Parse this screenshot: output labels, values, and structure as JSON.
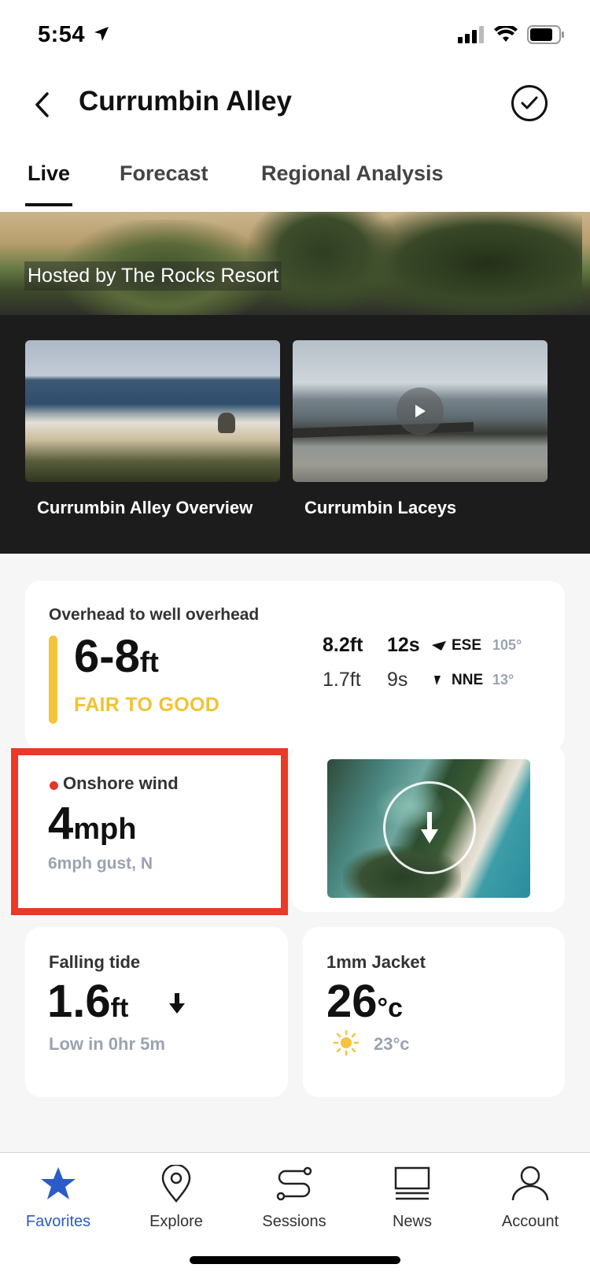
{
  "status_bar": {
    "time": "5:54"
  },
  "header": {
    "title": "Currumbin Alley"
  },
  "tabs": [
    {
      "label": "Live",
      "active": true
    },
    {
      "label": "Forecast",
      "active": false
    },
    {
      "label": "Regional Analysis",
      "active": false
    }
  ],
  "hero": {
    "hosted_by": "Hosted by The Rocks Resort"
  },
  "cameras": [
    {
      "label": "Currumbin Alley Overview"
    },
    {
      "label": "Currumbin Laceys"
    }
  ],
  "surf": {
    "description": "Overhead to well overhead",
    "height": "6-8",
    "unit": "ft",
    "rating": "FAIR TO GOOD",
    "rating_color": "#f1c332",
    "swells": [
      {
        "height": "8.2ft",
        "period": "12s",
        "direction": "ESE",
        "degrees": "105°"
      },
      {
        "height": "1.7ft",
        "period": "9s",
        "direction": "NNE",
        "degrees": "13°"
      }
    ]
  },
  "wind": {
    "label": "Onshore wind",
    "speed": "4",
    "unit": "mph",
    "gust": "6mph gust, N",
    "indicator_color": "#e0372b"
  },
  "tide": {
    "label": "Falling tide",
    "height": "1.6",
    "unit": "ft",
    "next": "Low in 0hr 5m"
  },
  "weather": {
    "wetsuit": "1mm Jacket",
    "water_temp": "26",
    "water_unit": "°c",
    "air_temp": "23°c"
  },
  "bottom_nav": [
    {
      "label": "Favorites",
      "icon": "star-icon",
      "active": true
    },
    {
      "label": "Explore",
      "icon": "map-pin-icon",
      "active": false
    },
    {
      "label": "Sessions",
      "icon": "sessions-icon",
      "active": false
    },
    {
      "label": "News",
      "icon": "news-icon",
      "active": false
    },
    {
      "label": "Account",
      "icon": "user-icon",
      "active": false
    }
  ],
  "colors": {
    "accent": "#2a5bc8",
    "highlight_border": "#e83a26"
  }
}
